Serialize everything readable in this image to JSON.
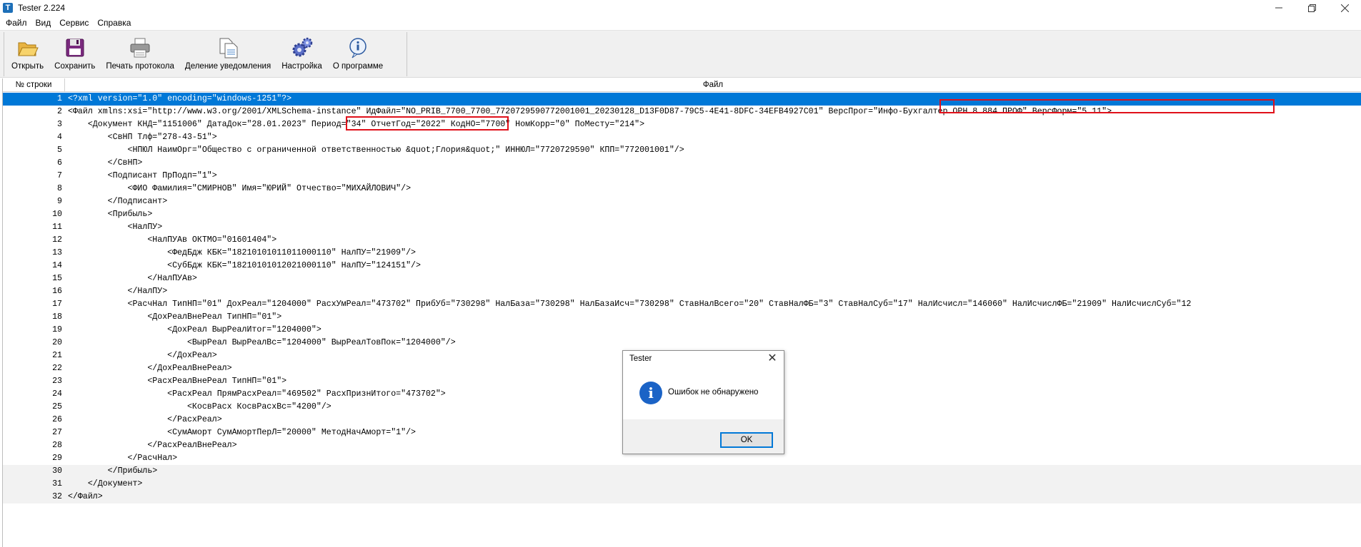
{
  "window": {
    "title": "Tester 2.224",
    "app_icon_letter": "T"
  },
  "menu": [
    "Файл",
    "Вид",
    "Сервис",
    "Справка"
  ],
  "toolbar": [
    {
      "label": "Открыть",
      "icon": "folder-open-icon"
    },
    {
      "label": "Сохранить",
      "icon": "floppy-disk-icon"
    },
    {
      "label": "Печать протокола",
      "icon": "printer-icon"
    },
    {
      "label": "Деление уведомления",
      "icon": "document-split-icon"
    },
    {
      "label": "Настройка",
      "icon": "gears-icon"
    },
    {
      "label": "О программе",
      "icon": "info-icon"
    }
  ],
  "grid": {
    "headers": {
      "line_no": "№ строки",
      "file": "Файл"
    },
    "selected_line": 1,
    "lines": [
      "<?xml version=\"1.0\" encoding=\"windows-1251\"?>",
      "<Файл xmlns:xsi=\"http://www.w3.org/2001/XMLSchema-instance\" ИдФайл=\"NO_PRIB_7700_7700_7720729590772001001_20230128_D13F0D87-79C5-4E41-8DFC-34EFB4927C01\" ВерсПрог=\"Инфо-Бухгалтер ОРН 8.884 ПРОФ\" ВерсФорм=\"5.11\">",
      "    <Документ КНД=\"1151006\" ДатаДок=\"28.01.2023\" Период=\"34\" ОтчетГод=\"2022\" КодНО=\"7700\" НомКорр=\"0\" ПоМесту=\"214\">",
      "        <СвНП Тлф=\"278-43-51\">",
      "            <НПЮЛ НаимОрг=\"Общество с ограниченной ответственностью &quot;Глория&quot;\" ИННЮЛ=\"7720729590\" КПП=\"772001001\"/>",
      "        </СвНП>",
      "        <Подписант ПрПодп=\"1\">",
      "            <ФИО Фамилия=\"СМИРНОВ\" Имя=\"ЮРИЙ\" Отчество=\"МИХАЙЛОВИЧ\"/>",
      "        </Подписант>",
      "        <Прибыль>",
      "            <НалПУ>",
      "                <НалПУАв ОКТМО=\"01601404\">",
      "                    <ФедБдж КБК=\"18210101011011000110\" НалПУ=\"21909\"/>",
      "                    <СубБдж КБК=\"18210101012021000110\" НалПУ=\"124151\"/>",
      "                </НалПУАв>",
      "            </НалПУ>",
      "            <РасчНал ТипНП=\"01\" ДохРеал=\"1204000\" РасхУмРеал=\"473702\" ПрибУб=\"730298\" НалБаза=\"730298\" НалБазаИсч=\"730298\" СтавНалВсего=\"20\" СтавНалФБ=\"3\" СтавНалСуб=\"17\" НалИсчисл=\"146060\" НалИсчислФБ=\"21909\" НалИсчислСуб=\"12",
      "                <ДохРеалВнеРеал ТипНП=\"01\">",
      "                    <ДохРеал ВырРеалИтог=\"1204000\">",
      "                        <ВырРеал ВырРеалВс=\"1204000\" ВырРеалТовПок=\"1204000\"/>",
      "                    </ДохРеал>",
      "                </ДохРеалВнеРеал>",
      "                <РасхРеалВнеРеал ТипНП=\"01\">",
      "                    <РасхРеал ПрямРасхРеал=\"469502\" РасхПризнИтого=\"473702\">",
      "                        <КосвРасх КосвРасхВс=\"4200\"/>",
      "                    </РасхРеал>",
      "                    <СумАморт СумАмортПерЛ=\"20000\" МетодНачАморт=\"1\"/>",
      "                </РасхРеалВнеРеал>",
      "            </РасчНал>",
      "        </Прибыль>",
      "    </Документ>",
      "</Файл>"
    ]
  },
  "dialog": {
    "title": "Tester",
    "message": "Ошибок не обнаружено",
    "ok_label": "OK"
  }
}
